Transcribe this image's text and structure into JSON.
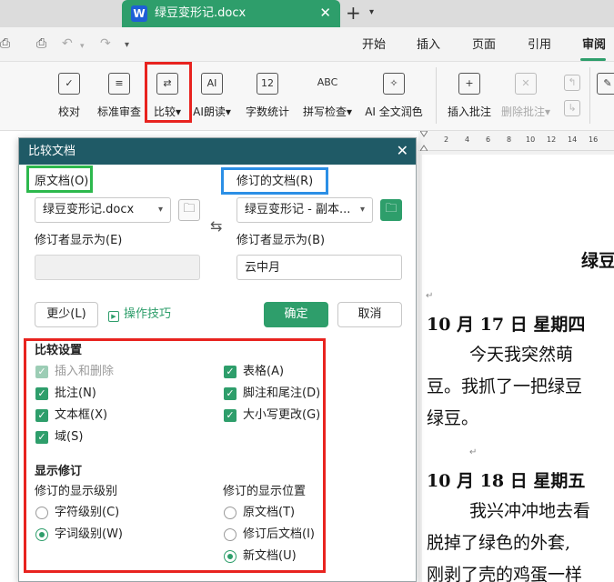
{
  "tabbar": {
    "doc_icon": "W",
    "doc_title": "绿豆变形记.docx",
    "close_glyph": "✕",
    "new_tab_glyph": "+",
    "dropdown_glyph": "▾"
  },
  "menu": {
    "items": [
      "开始",
      "插入",
      "页面",
      "引用",
      "审阅"
    ],
    "active": "审阅",
    "accent": "#2e9e6b"
  },
  "ribbon": {
    "buttons": [
      {
        "label": "校对",
        "icon": "proofread-icon"
      },
      {
        "label": "标准审查",
        "icon": "standard-review-icon"
      },
      {
        "label": "比较",
        "icon": "compare-icon"
      },
      {
        "label": "AI朗读",
        "icon": "ai-read-icon"
      },
      {
        "label": "字数统计",
        "icon": "word-count-icon"
      },
      {
        "label": "拼写检查",
        "icon": "spell-check-icon"
      },
      {
        "label": "AI 全文润色",
        "icon": "ai-polish-icon"
      },
      {
        "label": "插入批注",
        "icon": "insert-comment-icon"
      },
      {
        "label": "删除批注",
        "icon": "delete-comment-icon"
      }
    ],
    "glyphs": {
      "word_count": "12",
      "spell_check": "ABC"
    },
    "highlight_color": "#e8231f"
  },
  "ruler": {
    "ticks": [
      "2",
      "4",
      "6",
      "8",
      "10",
      "12",
      "14",
      "16"
    ]
  },
  "document": {
    "lines": [
      "绿豆",
      "10 月 17 日  星期四",
      "今天我突然萌",
      "豆。我抓了一把绿豆",
      "绿豆。",
      "10 月 18 日  星期五",
      "我兴冲冲地去看",
      "脱掉了绿色的外套,",
      "刚剥了壳的鸡蛋一样"
    ]
  },
  "dialog": {
    "title": "比较文档",
    "original_label": "原文档(O)",
    "original_value": "绿豆变形记.docx",
    "revised_label": "修订的文档(R)",
    "revised_value": "绿豆变形记 - 副本...",
    "original_author_label": "修订者显示为(E)",
    "original_author_value": "",
    "revised_author_label": "修订者显示为(B)",
    "revised_author_value": "云中月",
    "less_button": "更少(L)",
    "tips_link": "操作技巧",
    "ok_button": "确定",
    "cancel_button": "取消",
    "compare_settings_title": "比较设置",
    "checks_left": [
      {
        "label": "插入和删除",
        "checked": true,
        "disabled": true
      },
      {
        "label": "批注(N)",
        "checked": true,
        "disabled": false
      },
      {
        "label": "文本框(X)",
        "checked": true,
        "disabled": false
      },
      {
        "label": "域(S)",
        "checked": true,
        "disabled": false
      }
    ],
    "checks_right": [
      {
        "label": "表格(A)",
        "checked": true,
        "disabled": false
      },
      {
        "label": "脚注和尾注(D)",
        "checked": true,
        "disabled": false
      },
      {
        "label": "大小写更改(G)",
        "checked": true,
        "disabled": false
      }
    ],
    "show_revisions_title": "显示修订",
    "level_label": "修订的显示级别",
    "level_options": [
      {
        "label": "字符级别(C)",
        "selected": false
      },
      {
        "label": "字词级别(W)",
        "selected": true
      }
    ],
    "position_label": "修订的显示位置",
    "position_options": [
      {
        "label": "原文档(T)",
        "selected": false
      },
      {
        "label": "修订后文档(I)",
        "selected": false
      },
      {
        "label": "新文档(U)",
        "selected": true
      }
    ],
    "colors": {
      "title_bar": "#1f5a66",
      "accent": "#2e9e6b",
      "original_highlight": "#2db84d",
      "revised_highlight": "#2b8fe6",
      "settings_highlight": "#e8231f"
    }
  }
}
